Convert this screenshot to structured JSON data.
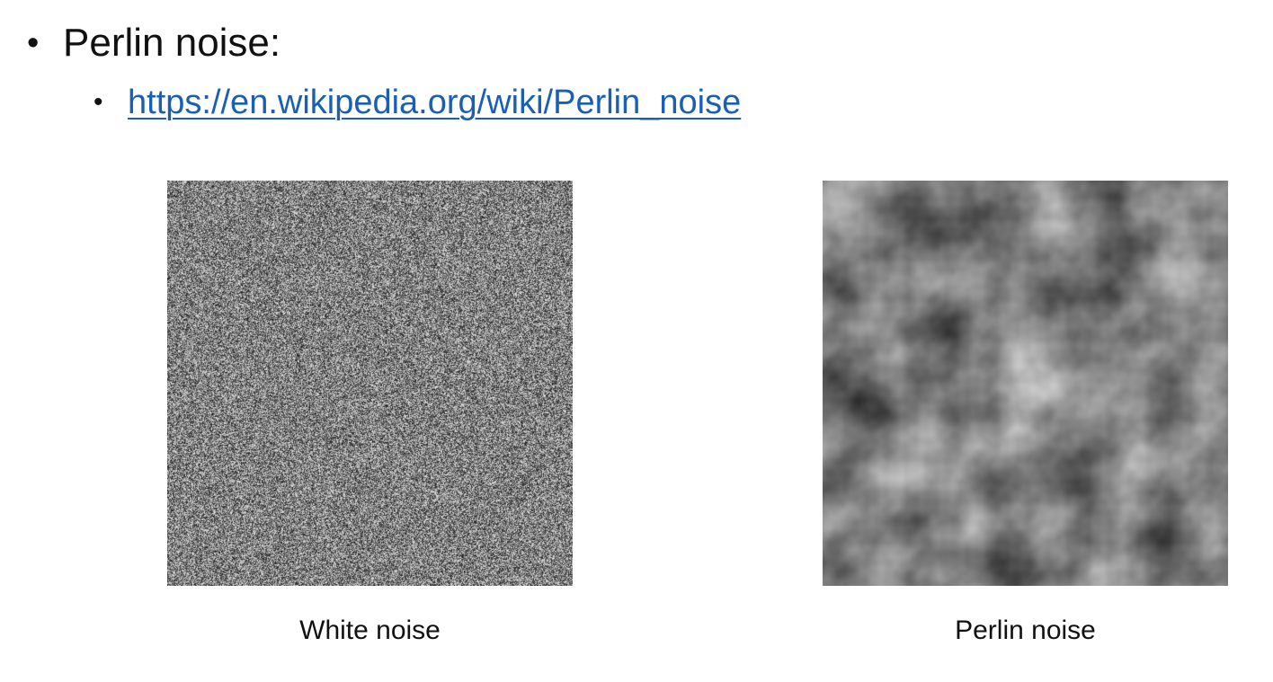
{
  "slide": {
    "heading": "Perlin noise:",
    "bullet_glyph": "•",
    "link_text": "https://en.wikipedia.org/wiki/Perlin_noise"
  },
  "figures": [
    {
      "caption": "White noise",
      "kind": "white-noise"
    },
    {
      "caption": "Perlin noise",
      "kind": "perlin-noise"
    }
  ],
  "colors": {
    "link": "#1a5fb4",
    "text": "#111111"
  }
}
